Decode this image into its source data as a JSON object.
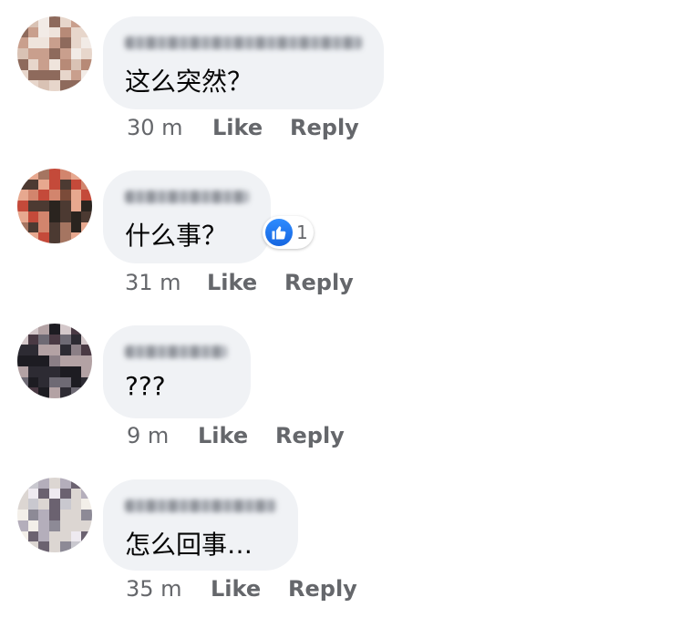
{
  "comments": [
    {
      "text": "这么突然？",
      "time": "30 m",
      "like_label": "Like",
      "reply_label": "Reply",
      "avatar_icon": "pixelated-avatar-icon",
      "avatar_colors": [
        "#d9c2b4",
        "#c99f8d",
        "#efe4dc",
        "#b78a77",
        "#8e6a5c",
        "#e7d6cb",
        "#f2ebe6"
      ]
    },
    {
      "text": "什么事？",
      "time": "31 m",
      "like_label": "Like",
      "reply_label": "Reply",
      "reaction_count": "1",
      "reaction_icon": "thumbs-up-icon",
      "avatar_icon": "pixelated-avatar-icon",
      "avatar_colors": [
        "#2a241f",
        "#7b4b39",
        "#d2856d",
        "#e7a88f",
        "#c44a3a",
        "#4c3a32",
        "#a57561"
      ]
    },
    {
      "text": "???",
      "time": "9 m",
      "like_label": "Like",
      "reply_label": "Reply",
      "avatar_icon": "pixelated-avatar-icon",
      "avatar_colors": [
        "#2d2b33",
        "#4a3a44",
        "#6e6a74",
        "#b3a2a4",
        "#1d1c22",
        "#8b7f86",
        "#d4c8ca"
      ]
    },
    {
      "text": "怎么回事…",
      "time": "35 m",
      "like_label": "Like",
      "reply_label": "Reply",
      "avatar_icon": "pixelated-avatar-icon",
      "avatar_colors": [
        "#c9c8cf",
        "#8d8a96",
        "#eeeaf0",
        "#6b6270",
        "#b4aebb",
        "#f3efe9",
        "#dcd6d2"
      ]
    }
  ],
  "colors": {
    "bubble_bg": "#f0f2f5",
    "meta_text": "#65676b",
    "body_text": "#050505",
    "like_blue": "#1877f2"
  }
}
